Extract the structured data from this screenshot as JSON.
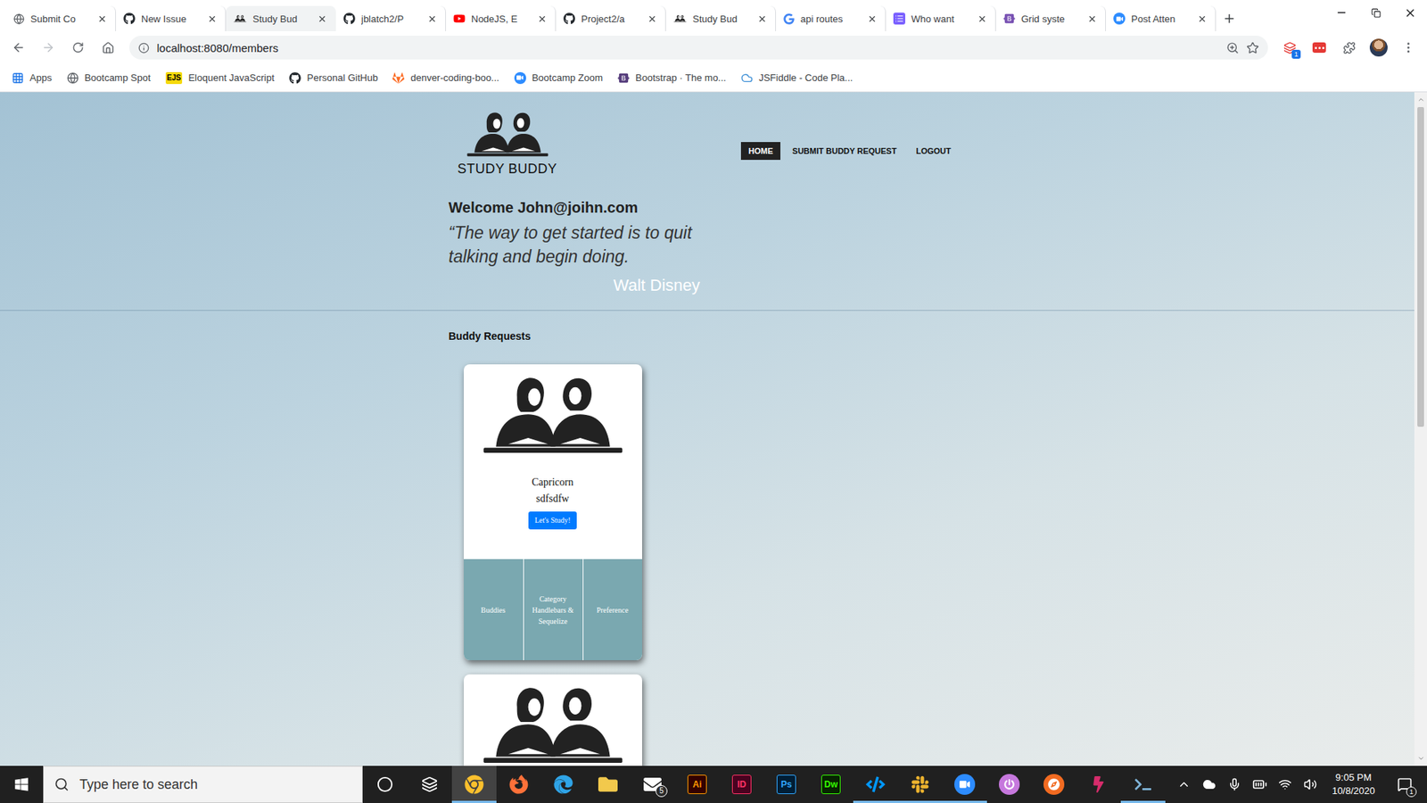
{
  "browser": {
    "tabs": [
      {
        "label": "Submit Co",
        "selected": false,
        "kind": "globe"
      },
      {
        "label": "New Issue",
        "selected": false,
        "kind": "github"
      },
      {
        "label": "Study Bud",
        "selected": true,
        "kind": "buddy"
      },
      {
        "label": "jblatch2/P",
        "selected": false,
        "kind": "github"
      },
      {
        "label": "NodeJS, E",
        "selected": false,
        "kind": "youtube"
      },
      {
        "label": "Project2/a",
        "selected": false,
        "kind": "github"
      },
      {
        "label": "Study Bud",
        "selected": false,
        "kind": "buddy"
      },
      {
        "label": "api routes",
        "selected": false,
        "kind": "google"
      },
      {
        "label": "Who want",
        "selected": false,
        "kind": "list"
      },
      {
        "label": "Grid syste",
        "selected": false,
        "kind": "bootstrap"
      },
      {
        "label": "Post Atten",
        "selected": false,
        "kind": "zoom"
      }
    ],
    "address": {
      "url": "localhost:8080/members"
    },
    "toolbar": {
      "extension_badge": "1"
    },
    "bookmarks": [
      {
        "label": "Apps",
        "kind": "apps"
      },
      {
        "label": "Bootcamp Spot",
        "kind": "globe"
      },
      {
        "label": "Eloquent JavaScript",
        "kind": "ejs",
        "glyph": "EJS"
      },
      {
        "label": "Personal GitHub",
        "kind": "github"
      },
      {
        "label": "denver-coding-boo...",
        "kind": "gitlab"
      },
      {
        "label": "Bootcamp Zoom",
        "kind": "zoom"
      },
      {
        "label": "Bootstrap · The mo...",
        "kind": "bootstrap"
      },
      {
        "label": "JSFiddle - Code Pla...",
        "kind": "cloud"
      }
    ]
  },
  "page": {
    "logo": "STUDY BUDDY",
    "nav": [
      {
        "label": "HOME",
        "selected": true
      },
      {
        "label": "SUBMIT BUDDY REQUEST",
        "selected": false
      },
      {
        "label": "LOGOUT",
        "selected": false
      }
    ],
    "welcome": "Welcome John@joihn.com",
    "quote": "“The way to get started is to quit talking and begin doing.",
    "author": "Walt Disney",
    "section": "Buddy Requests",
    "cards": [
      {
        "kind": "full",
        "title": "Capricorn",
        "text": "sdfsdfw",
        "button": "Let's Study!",
        "tiles": [
          "Buddies",
          "Category Handlebars & Sequelize",
          "Preference"
        ]
      },
      {
        "kind": "peek"
      }
    ]
  },
  "taskbar": {
    "search": {
      "placeholder": "Type here to search"
    },
    "apps": [
      {
        "kind": "cortana",
        "active": false,
        "running": false
      },
      {
        "kind": "taskview",
        "active": false,
        "running": false
      },
      {
        "kind": "chrome",
        "active": true,
        "running": true
      },
      {
        "kind": "firefox",
        "active": false,
        "running": false
      },
      {
        "kind": "edge",
        "active": false,
        "running": false
      },
      {
        "kind": "folder",
        "active": false,
        "running": false
      },
      {
        "kind": "mail",
        "active": false,
        "running": false,
        "badge": "5"
      },
      {
        "kind": "illustrator",
        "active": false,
        "running": false,
        "glyph": "Ai"
      },
      {
        "kind": "indesign",
        "active": false,
        "running": false,
        "glyph": "ID"
      },
      {
        "kind": "photoshop",
        "active": false,
        "running": false,
        "glyph": "Ps"
      },
      {
        "kind": "dreamweaver",
        "active": false,
        "running": false,
        "glyph": "Dw"
      },
      {
        "kind": "vscode",
        "active": false,
        "running": true
      },
      {
        "kind": "slack",
        "active": false,
        "running": true
      },
      {
        "kind": "zoom",
        "active": false,
        "running": true
      },
      {
        "kind": "power",
        "active": false,
        "running": false
      },
      {
        "kind": "compass",
        "active": false,
        "running": false
      },
      {
        "kind": "bolt",
        "active": false,
        "running": false
      },
      {
        "kind": "terminal",
        "active": false,
        "running": true
      }
    ],
    "clock": {
      "time": "9:05 PM",
      "date": "10/8/2020"
    },
    "notifications": {
      "badge": "1"
    }
  }
}
